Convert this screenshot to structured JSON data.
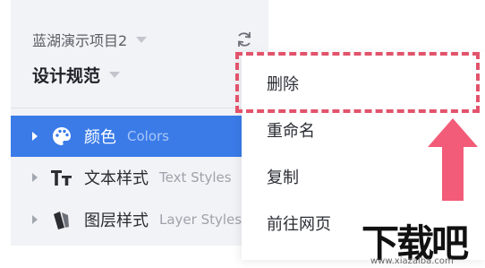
{
  "sidebar": {
    "project_name": "蓝湖演示项目2",
    "page_name": "设计规范",
    "items": [
      {
        "zh": "颜色",
        "en": "Colors",
        "icon": "palette-icon",
        "active": true
      },
      {
        "zh": "文本样式",
        "en": "Text Styles",
        "icon": "text-style-icon",
        "active": false
      },
      {
        "zh": "图层样式",
        "en": "Layer Styles",
        "icon": "layer-style-icon",
        "active": false
      }
    ]
  },
  "context_menu": {
    "items": [
      "删除",
      "重命名",
      "复制",
      "前往网页"
    ],
    "highlighted": "删除"
  },
  "annotation": {
    "color": "#e2536c",
    "shapes": [
      "dashed-box",
      "up-arrow"
    ]
  },
  "watermark": {
    "logo": "下载吧",
    "url": "www.xiazaiba.com"
  },
  "colors": {
    "accent": "#3a7be8",
    "sidebar_bg": "#f2f3f6",
    "annotation": "#e2536c"
  }
}
